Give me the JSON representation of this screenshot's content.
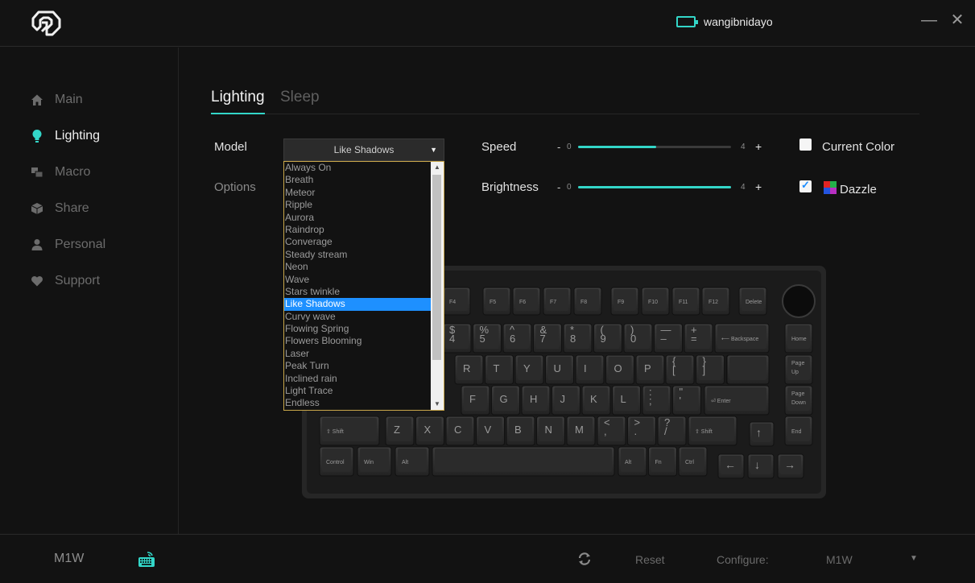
{
  "header": {
    "username": "wangibnidayo",
    "minimize_label": "—",
    "close_label": "✕",
    "accent_color": "#33d6c8"
  },
  "sidebar": {
    "items": [
      {
        "label": "Main",
        "icon": "home-icon",
        "active": false
      },
      {
        "label": "Lighting",
        "icon": "bulb-icon",
        "active": true
      },
      {
        "label": "Macro",
        "icon": "macro-icon",
        "active": false
      },
      {
        "label": "Share",
        "icon": "cube-icon",
        "active": false
      },
      {
        "label": "Personal",
        "icon": "user-icon",
        "active": false
      },
      {
        "label": "Support",
        "icon": "heart-icon",
        "active": false
      }
    ]
  },
  "tabs": [
    {
      "label": "Lighting",
      "active": true
    },
    {
      "label": "Sleep",
      "active": false
    }
  ],
  "lighting": {
    "model_label": "Model",
    "options_label": "Options",
    "model_selected": "Like Shadows",
    "model_options": [
      "Always On",
      "Breath",
      "Meteor",
      "Ripple",
      "Aurora",
      "Raindrop",
      "Converage",
      "Steady stream",
      "Neon",
      "Wave",
      "Stars twinkle",
      "Like Shadows",
      "Curvy wave",
      "Flowing Spring",
      "Flowers Blooming",
      "Laser",
      "Peak Turn",
      "Inclined rain",
      "Light Trace",
      "Endless"
    ],
    "speed": {
      "label": "Speed",
      "min": "0",
      "max": "4",
      "minus": "-",
      "plus": "+",
      "fraction": 0.51
    },
    "brightness": {
      "label": "Brightness",
      "min": "0",
      "max": "4",
      "minus": "-",
      "plus": "+",
      "fraction": 1.0
    },
    "current_color": {
      "label": "Current Color",
      "checked": false
    },
    "dazzle": {
      "label": "Dazzle",
      "checked": true
    }
  },
  "keyboard": {
    "fn_row": [
      "F4",
      "F5",
      "F6",
      "F7",
      "F8",
      "F9",
      "F10",
      "F11",
      "F12",
      "Delete"
    ],
    "num_row": [
      [
        "$",
        "4"
      ],
      [
        "%",
        "5"
      ],
      [
        "^",
        "6"
      ],
      [
        "&",
        "7"
      ],
      [
        "*",
        "8"
      ],
      [
        "(",
        "9"
      ],
      [
        ")",
        "0"
      ],
      [
        "—",
        "–"
      ],
      [
        "+",
        "="
      ]
    ],
    "backspace": "⟵ Backspace",
    "home": "Home",
    "q_row": [
      "R",
      "T",
      "Y",
      "U",
      "I",
      "O",
      "P"
    ],
    "q_row_sym": [
      [
        "{",
        "["
      ],
      [
        "}",
        "]"
      ],
      [
        "|",
        "\\"
      ]
    ],
    "pgup": [
      "Page",
      "Up"
    ],
    "a_row": [
      "F",
      "G",
      "H",
      "J",
      "K",
      "L"
    ],
    "a_row_sym": [
      [
        ":",
        ";"
      ],
      [
        "\"",
        "'"
      ]
    ],
    "enter": "⏎ Enter",
    "pgdn": [
      "Page",
      "Down"
    ],
    "lshift": "⇧ Shift",
    "z_row": [
      "Z",
      "X",
      "C",
      "V",
      "B",
      "N",
      "M"
    ],
    "z_row_sym": [
      [
        "<",
        ","
      ],
      [
        ">",
        "."
      ],
      [
        "?",
        "/"
      ]
    ],
    "rshift": "⇧ Shift",
    "up": "↑",
    "end": "End",
    "bottom_left": [
      "Control",
      "Win",
      "Alt"
    ],
    "bottom_right": [
      "Alt",
      "Fn",
      "Ctrl"
    ],
    "left": "←",
    "down": "↓",
    "right": "→"
  },
  "footer": {
    "device": "M1W",
    "reset_label": "Reset",
    "configure_label": "Configure:",
    "configure_value": "M1W"
  }
}
